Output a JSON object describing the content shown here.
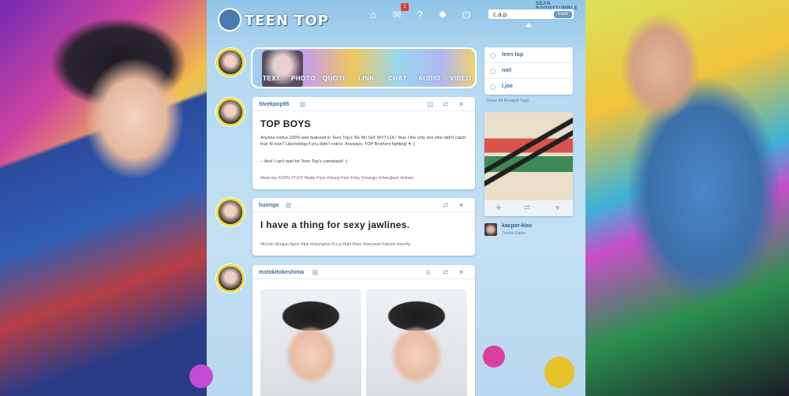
{
  "header": {
    "logo_text": "TEEN TOP",
    "username": "SEAN BOOMYTUMBLE",
    "mail_badge": "1",
    "search": {
      "value": "c.a.p",
      "button": "track"
    },
    "nav_icons": [
      "home-icon",
      "mail-icon",
      "help-icon",
      "gear-icon",
      "power-icon"
    ]
  },
  "post_types": [
    "TEXT",
    "PHOTO",
    "QUOTE",
    "LINK",
    "CHAT",
    "AUDIO",
    "VIDEO"
  ],
  "posts": [
    {
      "user": "t0vekpop95",
      "title": "TOP BOYS",
      "body_1": "Anyone notice 100% was featured in Teen Top's 'Be Mo Girl' MV? LOL! Was I the only one who didn't catch that 'til now? Like/reblog if you didn't notice. Anyways, TOP Brothers fighting! ♥ :)",
      "body_2": "-- And I can't wait for Teen Top's comeback! :)",
      "tags": "#teen top   #100%   #T.O.P Madie   #l.joe   #chunji   #niel   #ricky   #changjo   #chengbum   #minwo"
    },
    {
      "user": "huongo",
      "title": "I have a thing for sexy jawlines.",
      "tags": "#b1rain   #jongup   #jaon   #lipe   #myungsoo   #t.o.p   #tabi   #taec   #taecyeon   #ukwon   #woohy"
    },
    {
      "user": "mstokitokeshima"
    }
  ],
  "sidebar": {
    "tags": [
      "teen top",
      "niel",
      "l.joe"
    ],
    "related_link": "Show All Related Tags",
    "radar_user": "kacper-kiec",
    "radar_label": "Tumblr Radar"
  }
}
